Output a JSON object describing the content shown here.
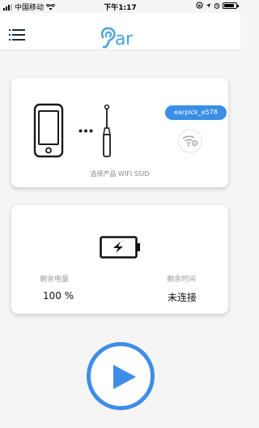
{
  "status_bar": {
    "carrier": "中国移动",
    "time": "下午1:17"
  },
  "nav": {
    "logo_text": "ar",
    "colors": {
      "logo": "#4aa3df"
    }
  },
  "device_card": {
    "ssid_badge": "earpick_e578",
    "label": "选择产品 WIFI SSID",
    "colors": {
      "badge": "#3a8ee6"
    }
  },
  "status_card": {
    "battery_label": "剩余电量",
    "battery_value": "100 %",
    "time_label": "剩余时间",
    "time_value": "未连接"
  },
  "play_button": {
    "color": "#3e8de8",
    "icon": "play-icon"
  }
}
